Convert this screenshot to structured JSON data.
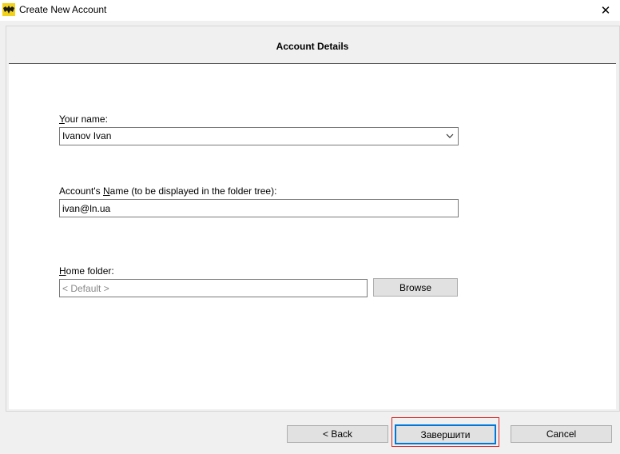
{
  "window": {
    "title": "Create New Account",
    "close_glyph": "✕"
  },
  "header": {
    "title": "Account Details"
  },
  "form": {
    "your_name": {
      "label_underlined": "Y",
      "label_rest": "our name:",
      "value": "Ivanov Ivan"
    },
    "account_name": {
      "label_before": "Account's ",
      "label_underlined": "N",
      "label_after": "ame (to be displayed in the folder tree):",
      "value": "ivan@ln.ua"
    },
    "home_folder": {
      "label_underlined": "H",
      "label_rest": "ome folder:",
      "placeholder": "< Default >",
      "browse_label": "Browse"
    }
  },
  "footer": {
    "back_label": "<  Back",
    "finish_label": "Завершити",
    "cancel_label": "Cancel"
  },
  "colors": {
    "default_button_border": "#0078d7",
    "highlight_frame": "#d92020"
  },
  "icons": {
    "app": "bat-icon",
    "close": "close-icon",
    "dropdown": "chevron-down-icon"
  }
}
